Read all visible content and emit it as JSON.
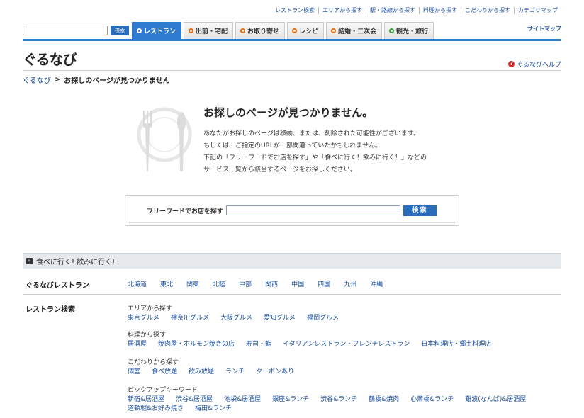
{
  "topnav": [
    "レストラン検索",
    "エリアから探す",
    "駅・路線から探す",
    "料理から探す",
    "こだわりから探す",
    "カテゴリマップ"
  ],
  "top_search": {
    "button": "検索"
  },
  "tabs": [
    {
      "label": "レストラン",
      "active": true
    },
    {
      "label": "出前・宅配"
    },
    {
      "label": "お取り寄せ"
    },
    {
      "label": "レシピ"
    },
    {
      "label": "結婚・二次会"
    },
    {
      "label": "観光・旅行"
    }
  ],
  "sitemap": "サイトマップ",
  "logo": "ぐるなび",
  "help": {
    "icon": "?",
    "label": "ぐるなびヘルプ"
  },
  "breadcrumb": {
    "home": "ぐるなび",
    "sep": ">",
    "current": "お探しのページが見つかりません"
  },
  "error": {
    "title": "お探しのページが見つかりません。",
    "lines": [
      "あなたがお探しのページは移動、または、削除された可能性がございます。",
      "もしくは、ご指定のURLが一部間違っていたかもしれません。",
      "下記の「フリーワードでお店を探す」や「食べに行く！飲みに行く！」などの",
      "サービス一覧から該当するページをお探しください。"
    ]
  },
  "free_search": {
    "label": "フリーワードでお店を探す",
    "button": "検索"
  },
  "section": {
    "icon": "»",
    "title": "食べに行く! 飲みに行く!"
  },
  "restaurants": {
    "label": "ぐるなびレストラン",
    "regions": [
      "北海道",
      "東北",
      "関東",
      "北陸",
      "中部",
      "関西",
      "中国",
      "四国",
      "九州",
      "沖縄"
    ]
  },
  "search": {
    "label": "レストラン検索",
    "groups": [
      {
        "title": "エリアから探す",
        "links": [
          "東京グルメ",
          "神奈川グルメ",
          "大阪グルメ",
          "愛知グルメ",
          "福岡グルメ"
        ]
      },
      {
        "title": "料理から探す",
        "links": [
          "居酒屋",
          "焼肉屋・ホルモン焼きの店",
          "寿司・鮨",
          "イタリアンレストラン・フレンチレストラン",
          "日本料理店・郷土料理店"
        ]
      },
      {
        "title": "こだわりから探す",
        "links": [
          "個室",
          "食べ放題",
          "飲み放題",
          "ランチ",
          "クーポンあり"
        ]
      },
      {
        "title": "ピックアップキーワード",
        "links": [
          "新宿&居酒屋",
          "渋谷&居酒屋",
          "池袋&居酒屋",
          "銀座&ランチ",
          "渋谷&ランチ",
          "鶴橋&焼肉",
          "心斎橋&ランチ",
          "難波(なんば)&居酒屋",
          "道頓堀&お好み焼き",
          "梅田&ランチ"
        ]
      }
    ]
  }
}
